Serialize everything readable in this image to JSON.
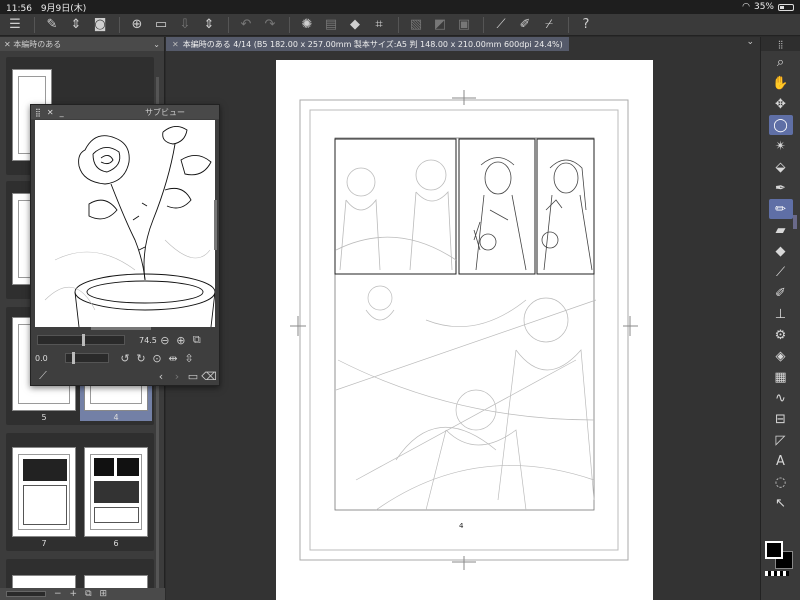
{
  "status": {
    "time": "11:56",
    "date": "9月9日(木)",
    "battery": "35%"
  },
  "toolbar": {
    "icons": [
      "menu-icon",
      "edit-icon",
      "stepper-icon",
      "layer-icon",
      "new-icon",
      "open-icon",
      "save-icon",
      "stepper2-icon",
      "undo-icon",
      "redo-icon",
      "loading-icon",
      "clear-icon",
      "fill-icon",
      "transform-icon",
      "deselect-icon",
      "invert-icon",
      "select-icon",
      "ruler-icon",
      "pen-icon",
      "snap-icon",
      "help-icon"
    ]
  },
  "pages_panel": {
    "tab_label": "本編時のある",
    "page_labels": {
      "p5": "5",
      "p4": "4",
      "p7": "7",
      "p6": "6"
    },
    "bottom": {
      "minus": "−",
      "plus": "+"
    }
  },
  "doc_tab": {
    "label": "本編時のある 4/14 (B5 182.00 x 257.00mm 製本サイズ:A5 判 148.00 x 210.00mm 600dpi 24.4%)"
  },
  "paper": {
    "page_number": "4"
  },
  "subview": {
    "title": "サブビュー",
    "zoom_value": "74.5",
    "rotate_value": "0.0"
  },
  "right_tools": {
    "active": "selection-lasso"
  }
}
